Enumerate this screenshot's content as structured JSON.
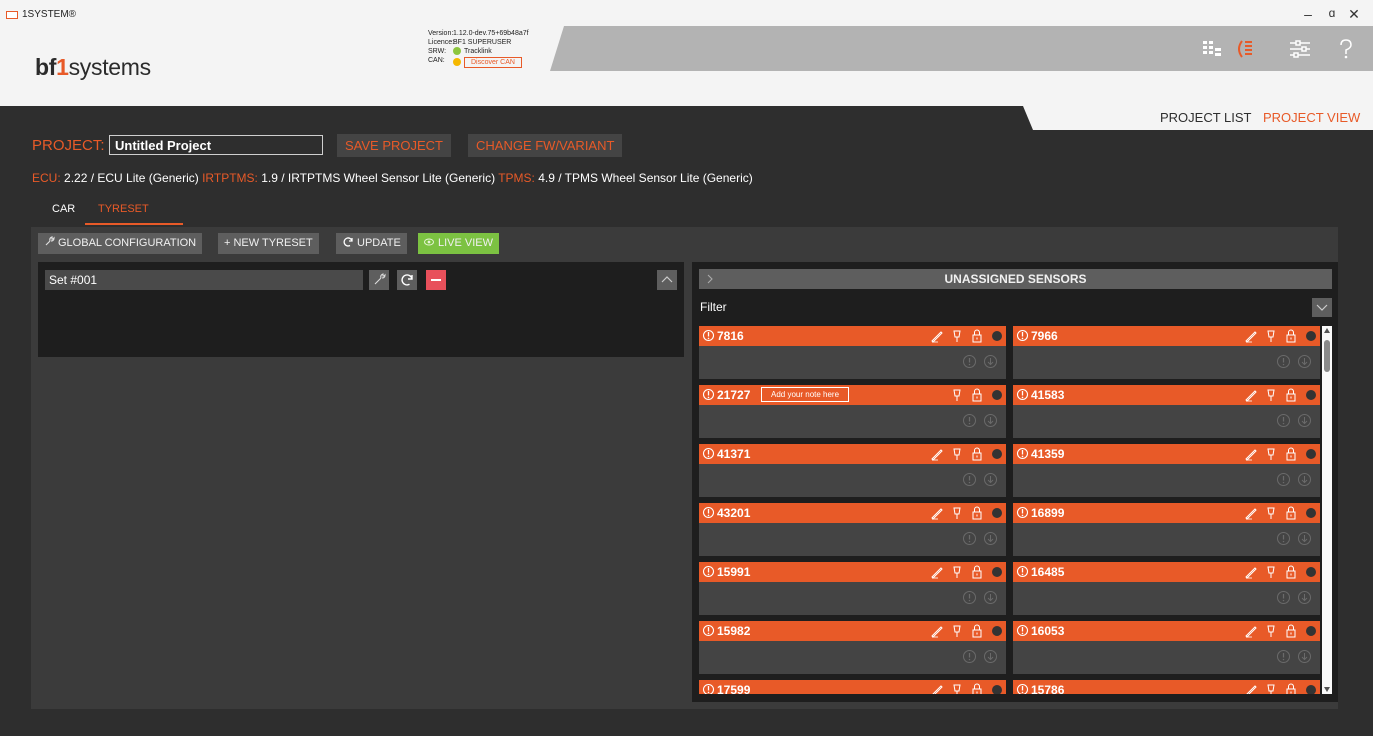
{
  "window": {
    "title": "1SYSTEM®",
    "controls": {
      "minimize": "–",
      "restore": "ɑ",
      "close": "✕"
    }
  },
  "header": {
    "logo": {
      "bf": "bf",
      "one": "1",
      "systems": "systems"
    },
    "info": {
      "version_label": "Version:",
      "version": "1.12.0-dev.75+69b48a7f",
      "licence_label": "Licence:",
      "licence": "BF1 SUPERUSER",
      "srw_label": "SRW:",
      "srw": "Tracklink",
      "can_label": "CAN:",
      "can_button": "Discover CAN"
    },
    "status_colors": {
      "srw": "#8dc63f",
      "can": "#f5b800"
    },
    "icons": [
      "grid-icon",
      "ecu-icon",
      "sliders-icon",
      "help-icon"
    ]
  },
  "nav": {
    "project_list": "PROJECT LIST",
    "project_view": "PROJECT VIEW",
    "active": "project_view"
  },
  "project": {
    "label": "PROJECT:",
    "name": "Untitled Project",
    "save_button": "SAVE PROJECT",
    "change_button": "CHANGE FW/VARIANT"
  },
  "firmware": {
    "ecu_label": "ECU:",
    "ecu": "2.22 / ECU Lite (Generic)",
    "irtptms_label": "IRTPTMS:",
    "irtptms": "1.9 / IRTPTMS Wheel Sensor Lite (Generic)",
    "tpms_label": "TPMS:",
    "tpms": "4.9 / TPMS Wheel Sensor Lite (Generic)"
  },
  "tabs": {
    "car": "CAR",
    "tyreset": "TYRESET",
    "active": "tyreset"
  },
  "toolbar": {
    "global_configuration": "GLOBAL CONFIGURATION",
    "new_tyreset": "+ NEW TYRESET",
    "update": "UPDATE",
    "live_view": "LIVE VIEW"
  },
  "tyresets": [
    {
      "name": "Set #001"
    }
  ],
  "unassigned": {
    "title": "UNASSIGNED SENSORS",
    "filter_label": "Filter",
    "sensors": [
      {
        "id": "7816",
        "note": ""
      },
      {
        "id": "7966",
        "note": ""
      },
      {
        "id": "21727",
        "note": "Add your note here"
      },
      {
        "id": "41583",
        "note": ""
      },
      {
        "id": "41371",
        "note": ""
      },
      {
        "id": "41359",
        "note": ""
      },
      {
        "id": "43201",
        "note": ""
      },
      {
        "id": "16899",
        "note": ""
      },
      {
        "id": "15991",
        "note": ""
      },
      {
        "id": "16485",
        "note": ""
      },
      {
        "id": "15982",
        "note": ""
      },
      {
        "id": "16053",
        "note": ""
      },
      {
        "id": "17599",
        "note": ""
      },
      {
        "id": "15786",
        "note": ""
      }
    ]
  },
  "colors": {
    "accent": "#e85a28",
    "live": "#7cc242",
    "panel": "#1e1e1e",
    "background": "#2e2e2e"
  }
}
